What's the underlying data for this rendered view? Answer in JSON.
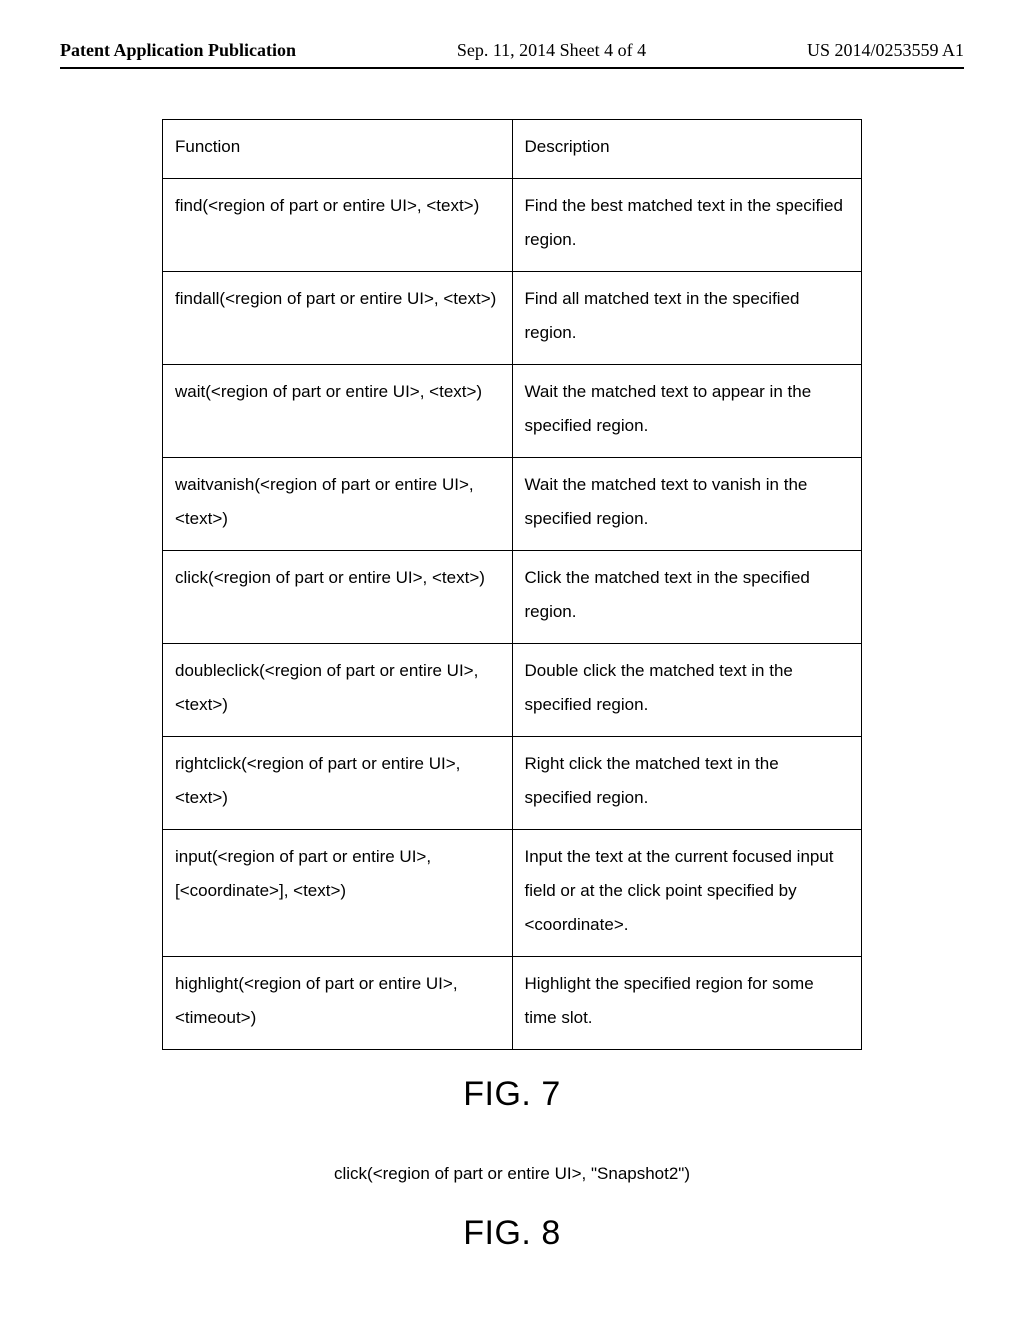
{
  "header": {
    "left": "Patent Application Publication",
    "mid": "Sep. 11, 2014  Sheet 4 of 4",
    "right": "US 2014/0253559 A1"
  },
  "table": {
    "headers": {
      "func": "Function",
      "desc": "Description"
    },
    "rows": [
      {
        "func": "find(<region of part or entire UI>, <text>)",
        "desc": "Find the best matched text in the specified region."
      },
      {
        "func": "findall(<region of part or entire UI>, <text>)",
        "desc": "Find all matched text in the specified region."
      },
      {
        "func": "wait(<region of part or entire UI>, <text>)",
        "desc": "Wait the matched text to appear in the specified region."
      },
      {
        "func": "waitvanish(<region of part or entire UI>, <text>)",
        "desc": "Wait the matched text to vanish in the specified region."
      },
      {
        "func": "click(<region of part or entire UI>, <text>)",
        "desc": "Click the matched text in the specified region."
      },
      {
        "func": "doubleclick(<region of part or entire UI>, <text>)",
        "desc": "Double click the matched text in the specified region."
      },
      {
        "func": "rightclick(<region of part or entire UI>, <text>)",
        "desc": "Right click the matched text in the specified region."
      },
      {
        "func": "input(<region of part or entire UI>, [<coordinate>], <text>)",
        "desc": "Input the text at the current focused input field or at the click point specified by <coordinate>."
      },
      {
        "func": "highlight(<region of part or entire UI>, <timeout>)",
        "desc": "Highlight the specified region for some time slot."
      }
    ]
  },
  "fig7_label": "FIG. 7",
  "code_line": "click(<region of part or entire UI>, \"Snapshot2\")",
  "fig8_label": "FIG. 8"
}
